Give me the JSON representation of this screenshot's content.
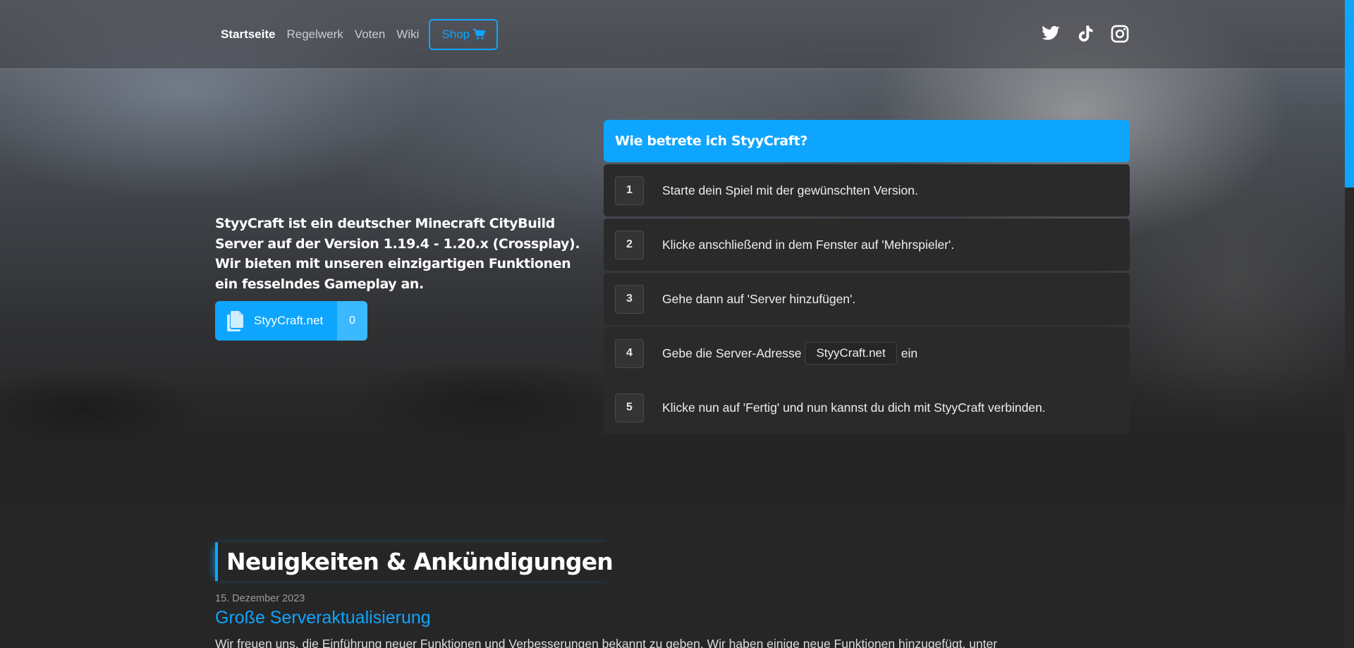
{
  "nav": {
    "links": [
      "Startseite",
      "Regelwerk",
      "Voten",
      "Wiki"
    ],
    "shop_label": "Shop",
    "social_icons": [
      "twitter-icon",
      "tiktok-icon",
      "instagram-icon"
    ]
  },
  "hero": {
    "description": "StyyCraft ist ein deutscher Minecraft CityBuild Server auf der Version 1.19.4 - 1.20.x (Crossplay). Wir bieten mit unseren einzigartigen Funktionen ein fesselndes Gameplay an.",
    "copy_button": {
      "label": "StyyCraft.net",
      "count": "0"
    }
  },
  "steps": {
    "title": "Wie betrete ich StyyCraft?",
    "items": [
      {
        "num": "1",
        "text": "Starte dein Spiel mit der gewünschten Version."
      },
      {
        "num": "2",
        "text": "Klicke anschließend in dem Fenster auf 'Mehrspieler'."
      },
      {
        "num": "3",
        "text": "Gehe dann auf 'Server hinzufügen'."
      },
      {
        "num": "4",
        "text_before": "Gebe die Server-Adresse",
        "address": "StyyCraft.net",
        "text_after": "ein"
      },
      {
        "num": "5",
        "text": "Klicke nun auf 'Fertig' und nun kannst du dich mit StyyCraft verbinden."
      }
    ]
  },
  "news": {
    "section_title": "Neuigkeiten & Ankündigungen",
    "date": "15. Dezember 2023",
    "headline": "Große Serveraktualisierung",
    "body": "Wir freuen uns, die Einführung neuer Funktionen und Verbesserungen bekannt zu geben. Wir haben einige neue Funktionen hinzugefügt, unter"
  },
  "colors": {
    "accent": "#0ea5ff",
    "panel": "#2a2a2a",
    "background": "#262626"
  }
}
